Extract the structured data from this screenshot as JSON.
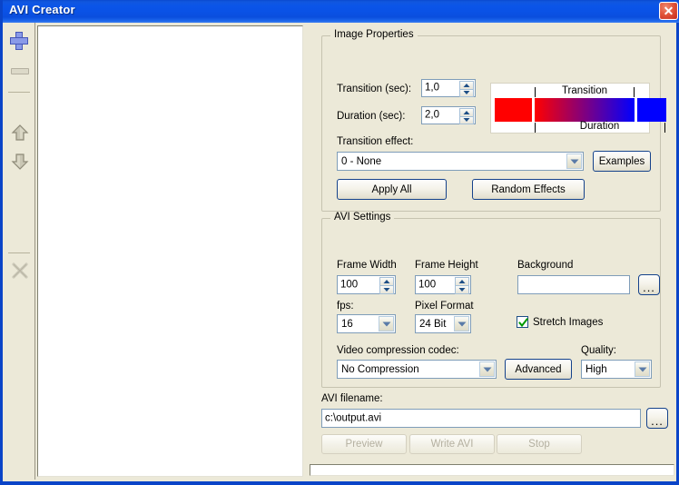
{
  "window": {
    "title": "AVI Creator",
    "close_label": "✕",
    "accent_title_blue": "#0a52e6",
    "face_color": "#ece9d8"
  },
  "toolbar": {
    "items": [
      {
        "name": "add-images-button",
        "icon": "plus-icon",
        "enabled": true
      },
      {
        "name": "remove-image-button",
        "icon": "minus-icon",
        "enabled": false
      },
      {
        "name": "move-up-button",
        "icon": "arrow-up-icon",
        "enabled": false
      },
      {
        "name": "move-down-button",
        "icon": "arrow-down-icon",
        "enabled": false
      },
      {
        "name": "clear-list-button",
        "icon": "close-x-icon",
        "enabled": false
      }
    ]
  },
  "image_list": {
    "items": []
  },
  "image_properties": {
    "group_title": "Image Properties",
    "transition_label": "Transition (sec):",
    "transition_value": "1,0",
    "duration_label": "Duration (sec):",
    "duration_value": "2,0",
    "preview": {
      "caption_top": "Transition",
      "caption_bottom": "Duration",
      "color_start": "#ff0000",
      "color_end": "#0000ff"
    },
    "effect_label": "Transition effect:",
    "effect_value": "0 - None",
    "effect_options": [
      "0 - None"
    ],
    "examples_label": "Examples",
    "apply_all_label": "Apply All",
    "random_effects_label": "Random Effects"
  },
  "avi_settings": {
    "group_title": "AVI Settings",
    "frame_width_label": "Frame Width",
    "frame_width_value": "100",
    "frame_height_label": "Frame Height",
    "frame_height_value": "100",
    "background_label": "Background",
    "background_value": "",
    "background_browse_label": "...",
    "fps_label": "fps:",
    "fps_value": "16",
    "fps_options": [
      "16"
    ],
    "pixel_format_label": "Pixel Format",
    "pixel_format_value": "24 Bit",
    "pixel_format_options": [
      "24 Bit"
    ],
    "stretch_images_label": "Stretch Images",
    "stretch_images_checked": true,
    "stretch_check_color": "#009900",
    "codec_label": "Video compression codec:",
    "codec_value": "No Compression",
    "codec_options": [
      "No Compression"
    ],
    "advanced_label": "Advanced",
    "quality_label": "Quality:",
    "quality_value": "High",
    "quality_options": [
      "High"
    ]
  },
  "output": {
    "filename_label": "AVI filename:",
    "filename_value": "c:\\output.avi",
    "filename_browse_label": "...",
    "preview_label": "Preview",
    "write_avi_label": "Write AVI",
    "stop_label": "Stop",
    "preview_enabled": false,
    "write_enabled": false,
    "stop_enabled": false
  },
  "status": {
    "progress_percent": 0,
    "text": ""
  }
}
